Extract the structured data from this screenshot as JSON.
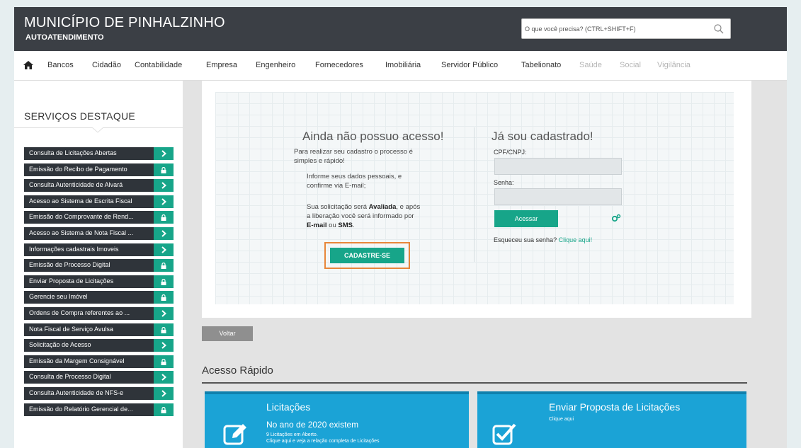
{
  "header": {
    "title": "MUNICÍPIO DE PINHALZINHO",
    "subtitle": "AUTOATENDIMENTO",
    "search_placeholder": "O que você precisa? (CTRL+SHIFT+F)"
  },
  "nav": {
    "items": [
      "Bancos",
      "Cidadão",
      "Contabilidade",
      "Empresa",
      "Engenheiro",
      "Fornecedores",
      "Imobiliária",
      "Servidor Público",
      "Tabelionato",
      "Saúde",
      "Social",
      "Vigilância"
    ]
  },
  "sidebar": {
    "title": "SERVIÇOS DESTAQUE",
    "items": [
      {
        "label": "Consulta de Licitações Abertas",
        "icon": "chevron-right-icon"
      },
      {
        "label": "Emissão do Recibo de Pagamento",
        "icon": "lock-icon"
      },
      {
        "label": "Consulta Autenticidade de Alvará",
        "icon": "chevron-right-icon"
      },
      {
        "label": "Acesso ao Sistema de Escrita Fiscal",
        "icon": "chevron-right-icon"
      },
      {
        "label": "Emissão do Comprovante de Rend...",
        "icon": "lock-icon"
      },
      {
        "label": "Acesso ao Sistema de Nota Fiscal ...",
        "icon": "chevron-right-icon"
      },
      {
        "label": "Informações cadastrais Imoveis",
        "icon": "chevron-right-icon"
      },
      {
        "label": "Emissão de Processo Digital",
        "icon": "lock-icon"
      },
      {
        "label": "Enviar Proposta de Licitações",
        "icon": "lock-icon"
      },
      {
        "label": "Gerencie seu Imóvel",
        "icon": "lock-icon"
      },
      {
        "label": "Ordens de Compra referentes ao ...",
        "icon": "chevron-right-icon"
      },
      {
        "label": "Nota Fiscal de Serviço Avulsa",
        "icon": "lock-icon"
      },
      {
        "label": "Solicitação de Acesso",
        "icon": "chevron-right-icon"
      },
      {
        "label": "Emissão da Margem Consignável",
        "icon": "lock-icon"
      },
      {
        "label": "Consulta de Processo Digital",
        "icon": "chevron-right-icon"
      },
      {
        "label": "Consulta Autenticidade de NFS-e",
        "icon": "chevron-right-icon"
      },
      {
        "label": "Emissão do Relatório Gerencial de...",
        "icon": "lock-icon"
      }
    ]
  },
  "register": {
    "heading": "Ainda não possuo acesso!",
    "intro_1": "Para realizar seu cadastro o processo é",
    "intro_2": "simples e rápido!",
    "step1_1": "Informe seus dados pessoais, e",
    "step1_2": "confirme via E-mail;",
    "step2_1a": "Sua solicitação será ",
    "step2_1b": "Avaliada",
    "step2_1c": ", e após",
    "step2_2": "a liberação você será informado por",
    "step2_3a": "E-mail",
    "step2_3b": " ou ",
    "step2_3c": "SMS",
    "step2_3d": ".",
    "button": "CADASTRE-SE"
  },
  "login": {
    "heading": "Já sou cadastrado!",
    "cpf_label": "CPF/CNPJ:",
    "password_label": "Senha:",
    "button": "Acessar",
    "forgot_text": "Esqueceu sua senha? ",
    "forgot_link": "Clique aqui!"
  },
  "back_button": "Voltar",
  "quick_access": {
    "title": "Acesso Rápido",
    "cards": [
      {
        "title": "Licitações",
        "subtitle": "No ano de 2020 existem",
        "small_1": "9 Licitações em Aberto.",
        "small_2": "Clique aqui e veja a relação completa de Licitações",
        "icon": "edit-icon"
      },
      {
        "title": "Enviar Proposta de Licitações",
        "small_1": "Clique aqui",
        "icon": "checkbox-icon"
      }
    ]
  },
  "colors": {
    "header": "#3b3f45",
    "accent": "#17a589",
    "card": "#1ba3d6",
    "highlight": "#e8863a"
  }
}
